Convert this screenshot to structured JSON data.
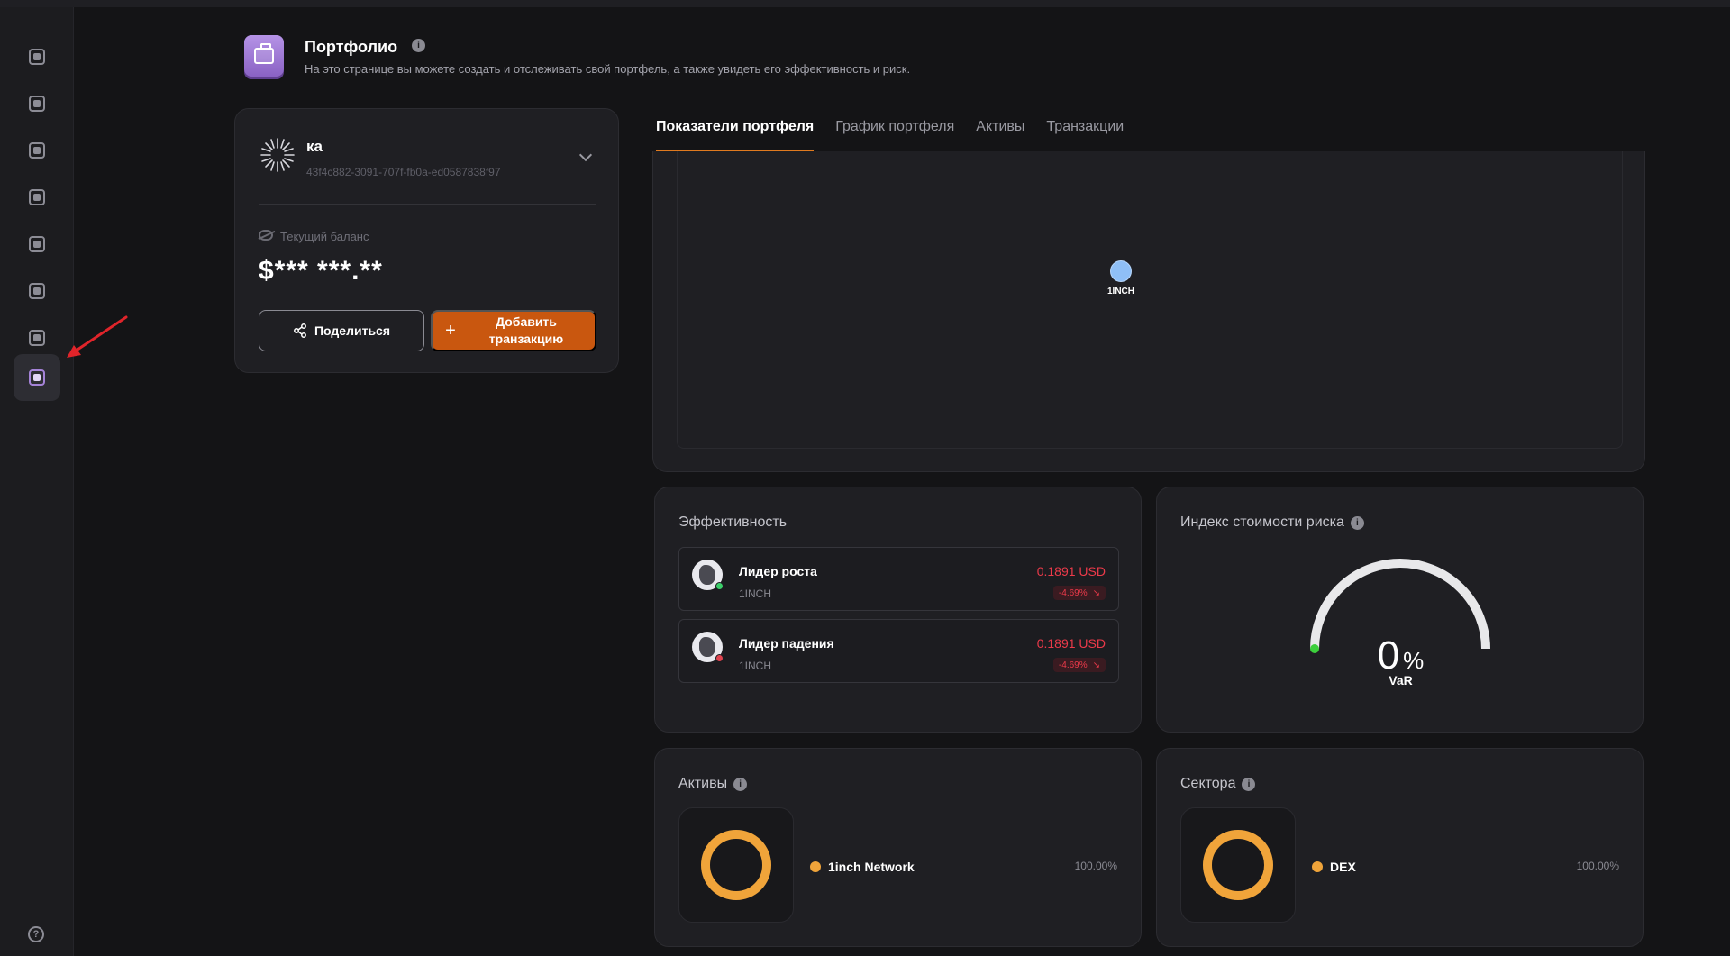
{
  "sidebar": {
    "items": [
      {
        "icon": "home-icon",
        "active": false
      },
      {
        "icon": "chart-icon",
        "active": false
      },
      {
        "icon": "coin-icon",
        "active": false
      },
      {
        "icon": "dollar-icon",
        "active": false
      },
      {
        "icon": "calculator-icon",
        "active": false
      },
      {
        "icon": "bank-icon",
        "active": false
      },
      {
        "icon": "target-icon",
        "active": false
      },
      {
        "icon": "portfolio-icon",
        "active": true
      }
    ],
    "help_label": "?"
  },
  "header": {
    "title": "Портфолио",
    "subtitle": "На это странице вы можете создать и отслеживать свой портфель, а также увидеть его эффективность и риск."
  },
  "portfolio": {
    "name": "ка",
    "id": "43f4c882-3091-707f-fb0a-ed0587838f97",
    "balance_label": "Текущий баланс",
    "balance_value": "$*** ***.**",
    "share_label": "Поделиться",
    "add_label": "Добавить транзакцию",
    "add_icon": "+"
  },
  "tabs": [
    {
      "label": "Показатели портфеля",
      "active": true
    },
    {
      "label": "График портфеля",
      "active": false
    },
    {
      "label": "Активы",
      "active": false
    },
    {
      "label": "Транзакции",
      "active": false
    }
  ],
  "bubble": {
    "label": "1INCH",
    "color": "#8fbff6"
  },
  "efficiency": {
    "title": "Эффективность",
    "leaders": [
      {
        "name": "Лидер роста",
        "symbol": "1INCH",
        "price": "0.1891 USD",
        "change": "-4.69%",
        "dot_color": "#3ccf6a"
      },
      {
        "name": "Лидер падения",
        "symbol": "1INCH",
        "price": "0.1891 USD",
        "change": "-4.69%",
        "dot_color": "#e0434f"
      }
    ]
  },
  "risk": {
    "title": "Индекс стоимости риска",
    "value": 0,
    "value_text": "0",
    "unit": "%",
    "label": "VaR",
    "track_color": "#e8e8ea",
    "marker_color": "#3ccf3c"
  },
  "assets": {
    "title": "Активы",
    "items": [
      {
        "name": "1inch Network",
        "percent": "100.00%",
        "share": 1.0,
        "color": "#f0a43a"
      }
    ]
  },
  "sectors": {
    "title": "Сектора",
    "items": [
      {
        "name": "DEX",
        "percent": "100.00%",
        "share": 1.0,
        "color": "#f0a43a"
      }
    ]
  },
  "colors": {
    "accent": "#c9570f",
    "tab_underline": "#e07a1f",
    "negative": "#ec3a4a"
  }
}
